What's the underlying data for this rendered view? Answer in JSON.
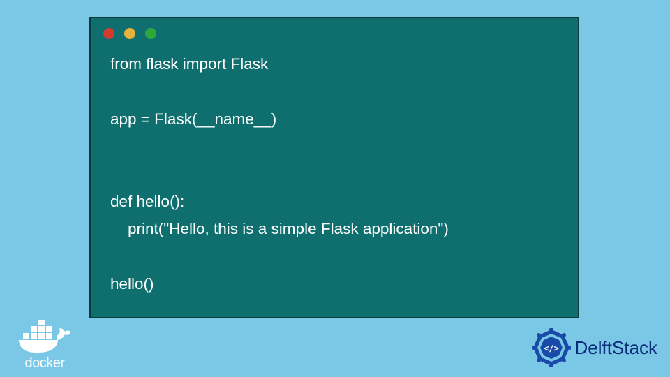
{
  "code": {
    "lines": [
      "from flask import Flask",
      "",
      "app = Flask(__name__)",
      "",
      "",
      "def hello():",
      "    print(\"Hello, this is a simple Flask application\")",
      "",
      "hello()"
    ]
  },
  "logos": {
    "docker": "docker",
    "delftstack": "DelftStack"
  },
  "colors": {
    "page_bg": "#7bc7e6",
    "code_bg": "#0f6f6f",
    "code_border": "#0a3a3a",
    "code_text": "#ffffff",
    "dot_red": "#d43b2e",
    "dot_yellow": "#e6b23a",
    "dot_green": "#2fa83b",
    "delft_text": "#0a2a7a",
    "delft_badge": "#1a4aa8"
  }
}
